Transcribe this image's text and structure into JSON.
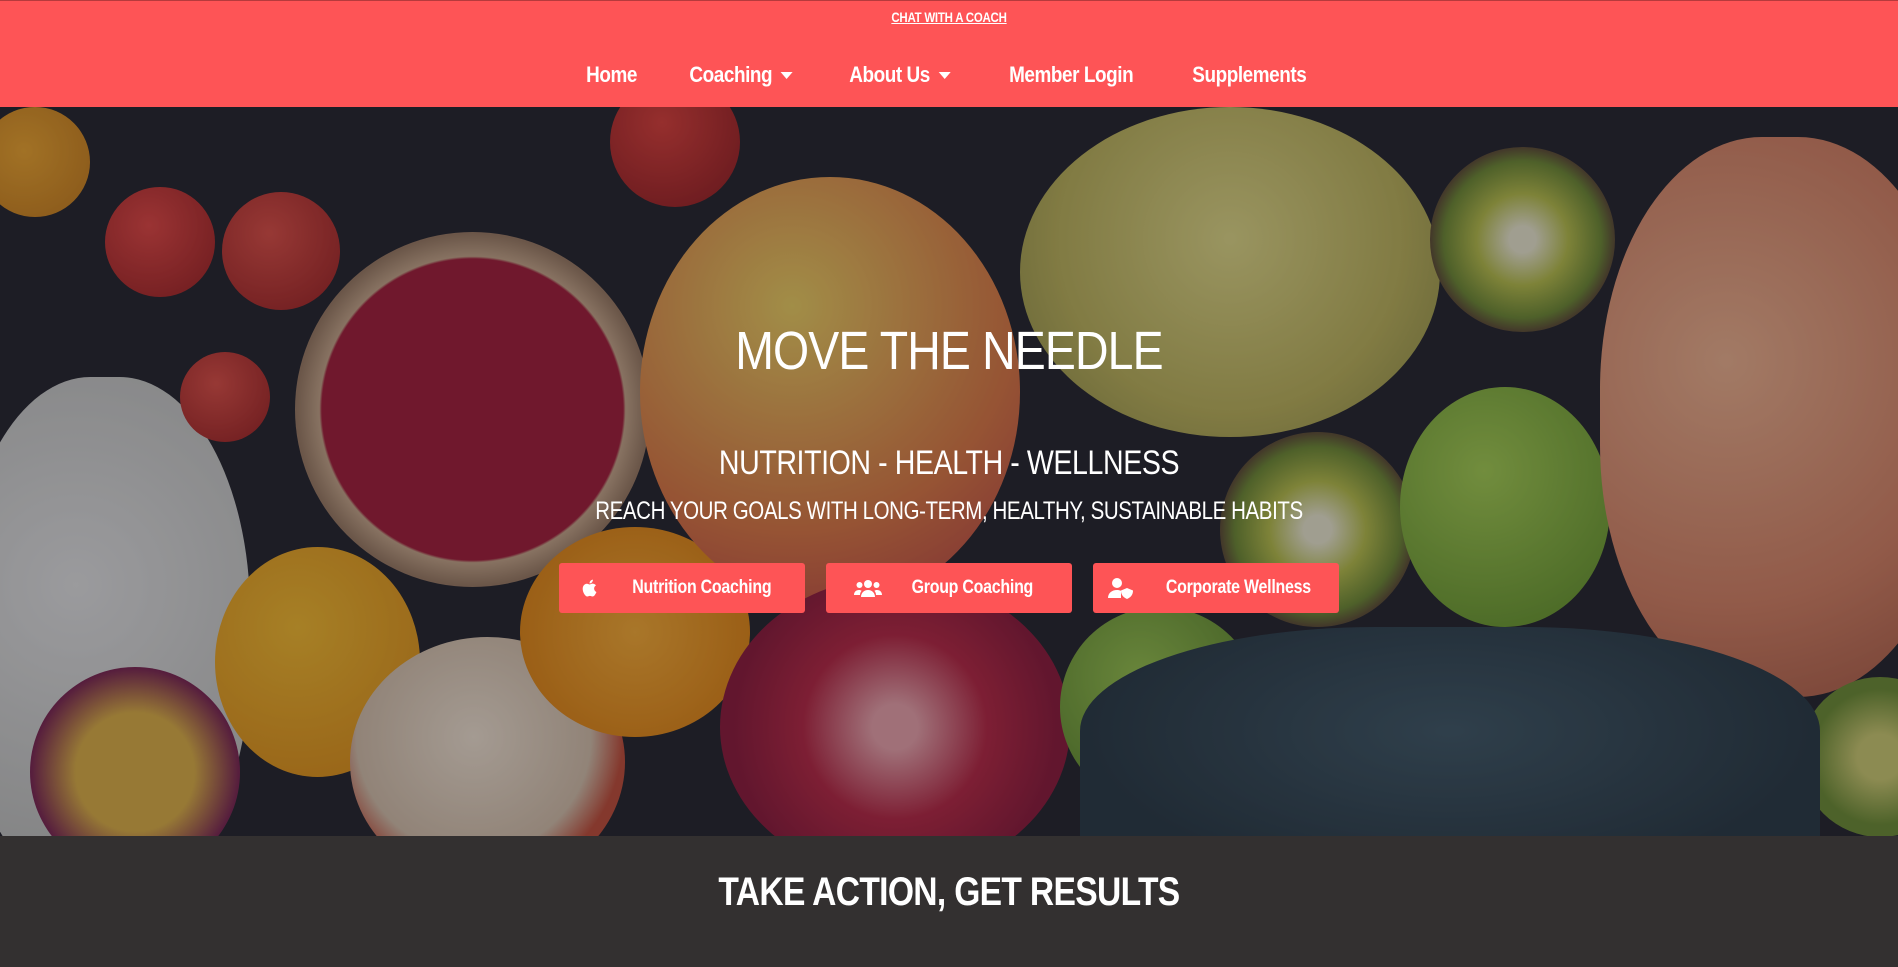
{
  "topbar": {
    "chat_link": "CHAT WITH A COACH",
    "nav": [
      {
        "label": "Home",
        "dropdown": false
      },
      {
        "label": "Coaching",
        "dropdown": true
      },
      {
        "label": "About Us",
        "dropdown": true
      },
      {
        "label": "Member Login",
        "dropdown": false
      },
      {
        "label": "Supplements",
        "dropdown": false
      }
    ]
  },
  "hero": {
    "title": "MOVE THE NEEDLE",
    "subtitle": "NUTRITION - HEALTH - WELLNESS",
    "tagline": "REACH YOUR GOALS WITH LONG-TERM, HEALTHY, SUSTAINABLE HABITS",
    "buttons": [
      {
        "label": "Nutrition Coaching",
        "icon": "apple-icon"
      },
      {
        "label": "Group Coaching",
        "icon": "users-icon"
      },
      {
        "label": "Corporate Wellness",
        "icon": "user-shield-icon"
      }
    ]
  },
  "section": {
    "title": "TAKE ACTION, GET RESULTS"
  },
  "colors": {
    "accent": "#fe5456",
    "dark": "#333030"
  }
}
